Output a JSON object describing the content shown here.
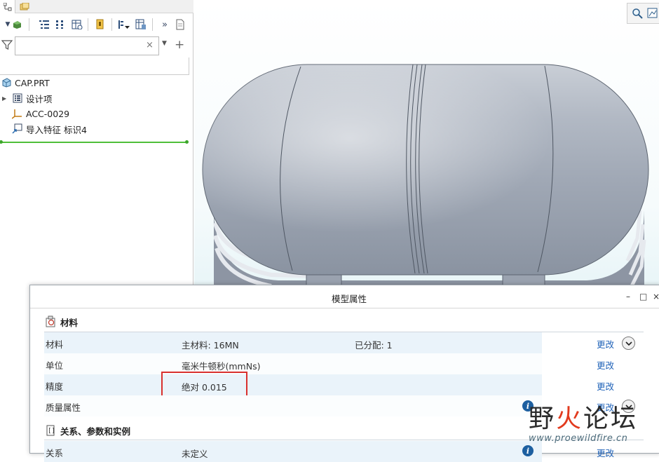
{
  "model_tree": {
    "filter": {
      "value": "",
      "clear_glyph": "×",
      "add_glyph": "+"
    },
    "items": [
      {
        "label": "CAP.PRT",
        "icon": "part-icon"
      },
      {
        "label": "设计项",
        "icon": "design-items-icon"
      },
      {
        "label": "ACC-0029",
        "icon": "coordinate-system-icon"
      },
      {
        "label": "导入特征 标识4",
        "icon": "import-feature-icon"
      }
    ]
  },
  "toolbar": {
    "more_glyph": "»"
  },
  "dialog": {
    "title": "模型属性",
    "window_buttons": [
      "–",
      "□",
      "×"
    ],
    "materials_section": {
      "title": "材料",
      "rows": [
        {
          "label": "材料",
          "value": "主材料: 16MN",
          "extra": "已分配: 1",
          "action": "更改"
        },
        {
          "label": "单位",
          "value": "毫米牛顿秒(mmNs)",
          "action": "更改"
        },
        {
          "label": "精度",
          "value": "绝对 0.015",
          "action": "更改"
        },
        {
          "label": "质量属性",
          "value": "",
          "action": "更改"
        }
      ]
    },
    "relations_section": {
      "title": "关系、参数和实例",
      "rows": [
        {
          "label": "关系",
          "value": "未定义",
          "action": "更改"
        }
      ]
    }
  },
  "watermark": {
    "text_a": "野",
    "text_fire": "火",
    "text_b": "论坛",
    "url": "www.proewildfire.cn"
  },
  "colors": {
    "accent_link": "#1f62b8",
    "highlight": "#d9302d",
    "insert_line": "#4fbf3a",
    "model": "#a7b0bd"
  }
}
